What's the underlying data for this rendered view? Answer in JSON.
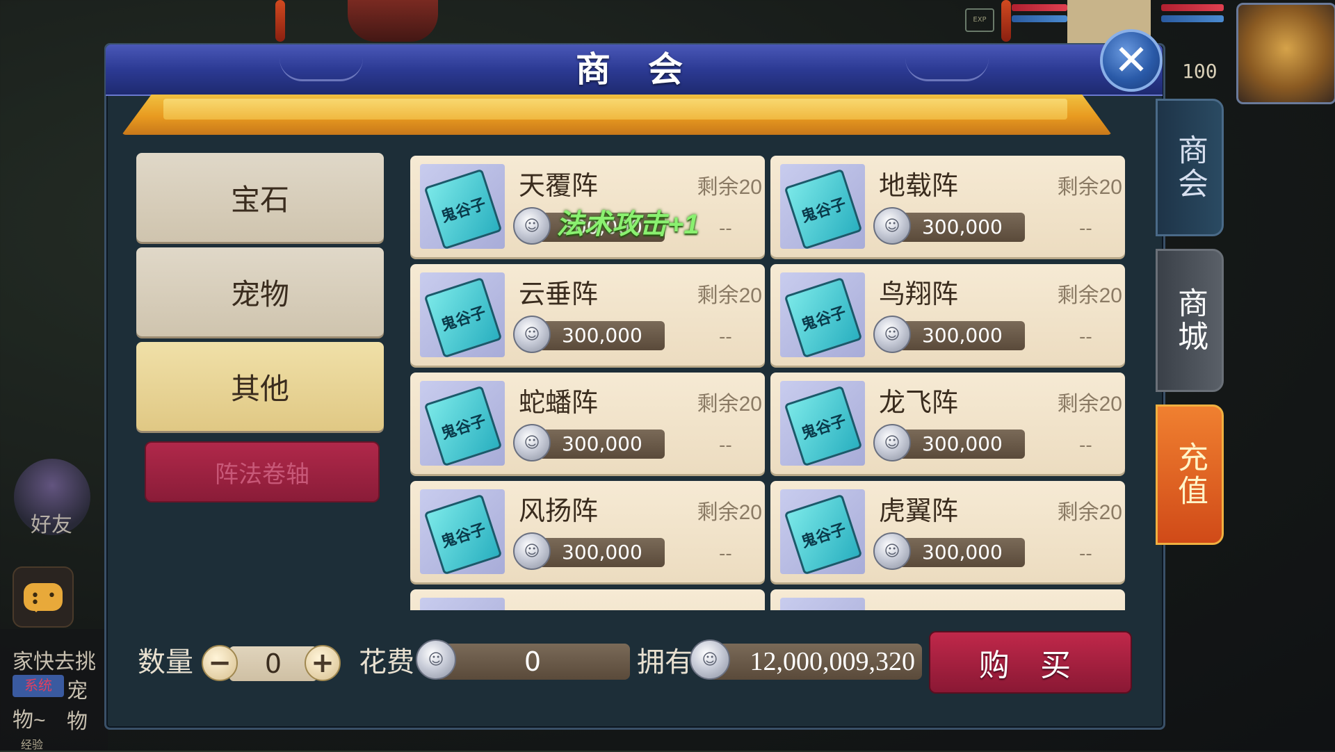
{
  "dialog": {
    "title": "商 会",
    "close_label": "✕"
  },
  "categories": [
    {
      "label": "宝石",
      "active": false
    },
    {
      "label": "宠物",
      "active": false
    },
    {
      "label": "其他",
      "active": true
    }
  ],
  "subcategory": {
    "label": "阵法卷轴"
  },
  "items": [
    {
      "name": "天覆阵",
      "remain": "剩余20",
      "price": "300,000",
      "extra": "--",
      "effect": "法术攻击+1"
    },
    {
      "name": "地载阵",
      "remain": "剩余20",
      "price": "300,000",
      "extra": "--"
    },
    {
      "name": "云垂阵",
      "remain": "剩余20",
      "price": "300,000",
      "extra": "--"
    },
    {
      "name": "鸟翔阵",
      "remain": "剩余20",
      "price": "300,000",
      "extra": "--"
    },
    {
      "name": "蛇蟠阵",
      "remain": "剩余20",
      "price": "300,000",
      "extra": "--"
    },
    {
      "name": "龙飞阵",
      "remain": "剩余20",
      "price": "300,000",
      "extra": "--"
    },
    {
      "name": "风扬阵",
      "remain": "剩余20",
      "price": "300,000",
      "extra": "--"
    },
    {
      "name": "虎翼阵",
      "remain": "剩余20",
      "price": "300,000",
      "extra": "--"
    }
  ],
  "item_icon_text": "鬼谷子",
  "coin_glyph": "☺",
  "side_tabs": {
    "shanghui": "商会",
    "shangcheng": "商城",
    "recharge": "充值"
  },
  "bottom": {
    "qty_label": "数量",
    "qty_value": "0",
    "minus": "−",
    "plus": "+",
    "cost_label": "花费",
    "cost_value": "0",
    "own_label": "拥有",
    "own_value": "12,000,009,320",
    "buy_label": "购 买"
  },
  "hud": {
    "level": "100"
  },
  "side_chat": {
    "friend_label": "好友",
    "line1": "家快去挑",
    "tag": "系统",
    "line2": "宠物",
    "line3": "物~",
    "exp_label": "经验"
  },
  "colors": {
    "title_bar": "#2c3a94",
    "buy_button": "#a0203e",
    "effect_green": "#8af070",
    "recharge_tab": "#e0602a"
  }
}
